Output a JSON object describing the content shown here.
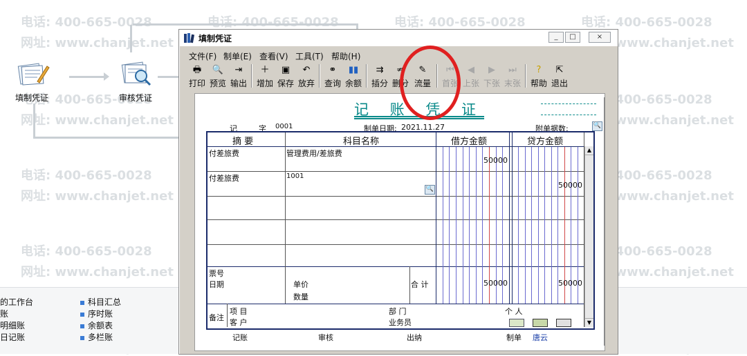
{
  "flow": {
    "step1": "填制凭证",
    "step2": "审核凭证"
  },
  "nav": {
    "left": [
      "的工作台",
      "账",
      "明细账",
      "日记账"
    ],
    "right": [
      "科目汇总",
      "序时账",
      "余额表",
      "多栏账"
    ]
  },
  "watermark": {
    "phone": "电话: 400-665-0028",
    "site": "网址: www.chanjet.net"
  },
  "window": {
    "title": "填制凭证",
    "minimize": "_",
    "restore": "□",
    "close": "×"
  },
  "menu": [
    "文件(F)",
    "制单(E)",
    "查看(V)",
    "工具(T)",
    "帮助(H)"
  ],
  "toolbar": [
    {
      "label": "打印",
      "icon": "printer-icon",
      "enabled": true
    },
    {
      "label": "预览",
      "icon": "preview-icon",
      "enabled": true
    },
    {
      "label": "输出",
      "icon": "export-icon",
      "enabled": true
    },
    {
      "label": "增加",
      "icon": "add-icon",
      "enabled": true
    },
    {
      "label": "保存",
      "icon": "save-icon",
      "enabled": true
    },
    {
      "label": "放弃",
      "icon": "undo-icon",
      "enabled": true
    },
    {
      "label": "查询",
      "icon": "binoculars-icon",
      "enabled": true
    },
    {
      "label": "余额",
      "icon": "bar-chart-icon",
      "enabled": true
    },
    {
      "label": "插分",
      "icon": "insert-row-icon",
      "enabled": true
    },
    {
      "label": "删分",
      "icon": "delete-row-icon",
      "enabled": true
    },
    {
      "label": "流量",
      "icon": "cash-flow-icon",
      "enabled": true
    },
    {
      "label": "首张",
      "icon": "first-icon",
      "enabled": false
    },
    {
      "label": "上张",
      "icon": "prev-icon",
      "enabled": false
    },
    {
      "label": "下张",
      "icon": "next-icon",
      "enabled": false
    },
    {
      "label": "末张",
      "icon": "last-icon",
      "enabled": false
    },
    {
      "label": "帮助",
      "icon": "help-icon",
      "enabled": true
    },
    {
      "label": "退出",
      "icon": "exit-icon",
      "enabled": true
    }
  ],
  "voucher": {
    "title": "记 账 凭 证",
    "type_label": "记",
    "no_label": "字",
    "number": "0001",
    "date_label": "制单日期:",
    "date": "2021.11.27",
    "attachments_label": "附单据数:",
    "headers": {
      "summary": "摘  要",
      "account": "科目名称",
      "debit": "借方金额",
      "credit": "贷方金额"
    },
    "rows": [
      {
        "summary": "付差旅费",
        "account": "管理费用/差旅费",
        "debit": "50000",
        "credit": ""
      },
      {
        "summary": "付差旅费",
        "account": "1001",
        "debit": "",
        "credit": "50000"
      }
    ],
    "footer": {
      "ticket_no": "票号",
      "date": "日期",
      "unit_price": "单价",
      "quantity": "数量",
      "total_label": "合 计",
      "total_debit": "50000",
      "total_credit": "50000"
    },
    "remarks": {
      "label": "备注",
      "project": "项  目",
      "customer": "客  户",
      "department": "部  门",
      "salesperson": "业务员",
      "individual": "个  人"
    },
    "signatures": {
      "bookkeeping": "记账",
      "review": "审核",
      "cashier": "出纳",
      "maker_label": "制单",
      "maker_name": "唐云"
    }
  },
  "colors": {
    "title_teal": "#0a8a8a",
    "grid_blue": "#6a6ad0",
    "grid_red": "#d04848",
    "highlight": "#e02020"
  }
}
